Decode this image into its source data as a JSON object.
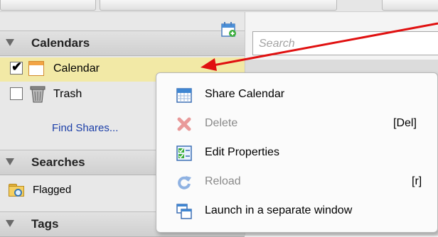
{
  "sidebar": {
    "calendars_header": "Calendars",
    "calendar_label": "Calendar",
    "trash_label": "Trash",
    "find_shares_label": "Find Shares...",
    "searches_header": "Searches",
    "flagged_label": "Flagged",
    "tags_header": "Tags"
  },
  "search": {
    "placeholder": "Search"
  },
  "context_menu": {
    "items": [
      {
        "label": "Share Calendar",
        "shortcut": "",
        "icon": "share-calendar-icon",
        "enabled": true
      },
      {
        "label": "Delete",
        "shortcut": "[Del]",
        "icon": "delete-icon",
        "enabled": false
      },
      {
        "label": "Edit Properties",
        "shortcut": "",
        "icon": "edit-properties-icon",
        "enabled": true
      },
      {
        "label": "Reload",
        "shortcut": "[r]",
        "icon": "reload-icon",
        "enabled": false
      },
      {
        "label": "Launch in a separate window",
        "shortcut": "",
        "icon": "launch-window-icon",
        "enabled": true
      }
    ]
  },
  "colors": {
    "selected_row": "#f2e9a6",
    "link": "#1c3fa8",
    "arrow": "#e01010"
  }
}
